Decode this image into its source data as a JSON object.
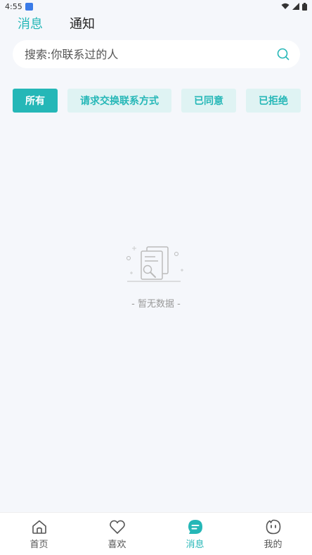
{
  "status_bar": {
    "time": "4:55"
  },
  "top_tabs": [
    {
      "label": "消息",
      "active": true
    },
    {
      "label": "通知",
      "active": false
    }
  ],
  "search": {
    "placeholder": "搜索:你联系过的人"
  },
  "filters": [
    {
      "label": "所有",
      "active": true
    },
    {
      "label": "请求交换联系方式",
      "active": false
    },
    {
      "label": "已同意",
      "active": false
    },
    {
      "label": "已拒绝",
      "active": false
    }
  ],
  "empty_state": {
    "text": "- 暂无数据 -"
  },
  "bottom_nav": [
    {
      "label": "首页",
      "icon": "home-icon",
      "active": false
    },
    {
      "label": "喜欢",
      "icon": "heart-icon",
      "active": false
    },
    {
      "label": "消息",
      "icon": "message-icon",
      "active": true
    },
    {
      "label": "我的",
      "icon": "profile-icon",
      "active": false
    }
  ],
  "colors": {
    "accent": "#25b7b7",
    "chip_bg": "#dff3f3",
    "page_bg": "#f5f7fb"
  }
}
